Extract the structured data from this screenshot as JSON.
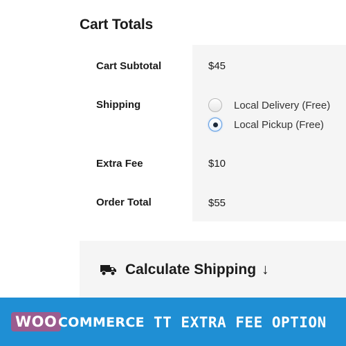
{
  "cart_totals": {
    "title": "Cart Totals",
    "subtotal": {
      "label": "Cart Subtotal",
      "value": "$45"
    },
    "shipping": {
      "label": "Shipping",
      "options": [
        {
          "label": "Local Delivery (Free)",
          "selected": false
        },
        {
          "label": "Local Pickup (Free)",
          "selected": true
        }
      ]
    },
    "extra_fee": {
      "label": "Extra Fee",
      "value": "$10"
    },
    "order_total": {
      "label": "Order Total",
      "value": "$55"
    }
  },
  "calculate_shipping": {
    "icon": "truck-icon",
    "label": "Calculate Shipping",
    "arrow": "↓"
  },
  "banner": {
    "brand_part1": "WOO",
    "brand_part2": "COMMERCE",
    "title": "TT EXTRA FEE OPTION",
    "background_color": "#1f8fd4",
    "brand_color": "#9b5c8f"
  }
}
